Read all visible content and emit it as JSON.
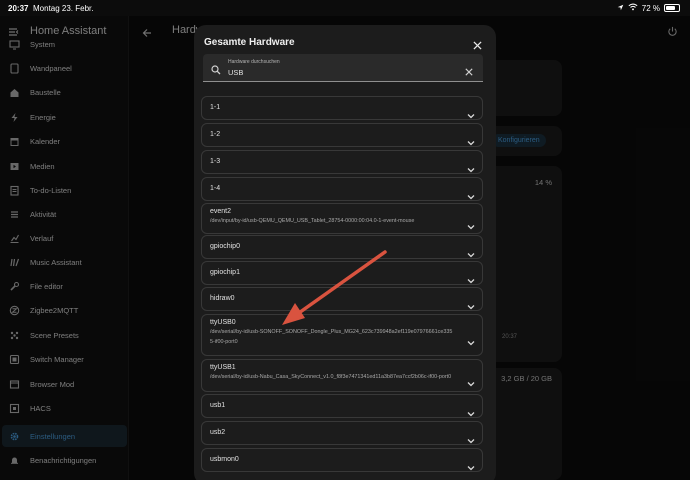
{
  "status": {
    "time": "20:37",
    "date": "Montag 23. Febr.",
    "battery": "72 %",
    "battery_level": 0.72
  },
  "sidebar": {
    "title": "Home Assistant",
    "items": [
      {
        "label": "System",
        "icon": "monitor-icon"
      },
      {
        "label": "Wandpaneel",
        "icon": "tablet-icon"
      },
      {
        "label": "Baustelle",
        "icon": "home-icon"
      },
      {
        "label": "Energie",
        "icon": "lightning-icon"
      },
      {
        "label": "Kalender",
        "icon": "calendar-icon"
      },
      {
        "label": "Medien",
        "icon": "media-icon"
      },
      {
        "label": "To-do-Listen",
        "icon": "clipboard-icon"
      },
      {
        "label": "Aktivität",
        "icon": "list-icon"
      },
      {
        "label": "Verlauf",
        "icon": "chart-icon"
      },
      {
        "label": "Music Assistant",
        "icon": "music-icon"
      },
      {
        "label": "File editor",
        "icon": "wrench-icon"
      },
      {
        "label": "Zigbee2MQTT",
        "icon": "zigbee-icon"
      },
      {
        "label": "Scene Presets",
        "icon": "palette-icon"
      },
      {
        "label": "Switch Manager",
        "icon": "switch-icon"
      },
      {
        "label": "Browser Mod",
        "icon": "browser-icon"
      },
      {
        "label": "HACS",
        "icon": "hacs-icon"
      },
      {
        "label": "Einstellungen",
        "icon": "gear-icon",
        "active": true
      },
      {
        "label": "Benachrichtigungen",
        "icon": "bell-icon"
      }
    ]
  },
  "page": {
    "title": "Hardware"
  },
  "background": {
    "configure_label": "Konfigurieren",
    "cpu_percent": "14 %",
    "time_tick": "20:37",
    "memory": "3,2 GB / 20 GB"
  },
  "dialog": {
    "title": "Gesamte Hardware",
    "search": {
      "placeholder": "Hardware durchsuchen",
      "value": "USB"
    },
    "items": [
      {
        "name": "1-1"
      },
      {
        "name": "1-2"
      },
      {
        "name": "1-3"
      },
      {
        "name": "1-4"
      },
      {
        "name": "event2",
        "path": "/dev/input/by-id/usb-QEMU_QEMU_USB_Tablet_28754-0000:00:04.0-1-event-mouse"
      },
      {
        "name": "gpiochip0"
      },
      {
        "name": "gpiochip1"
      },
      {
        "name": "hidraw0"
      },
      {
        "name": "ttyUSB0",
        "path": "/dev/serial/by-id/usb-SONOFF_SONOFF_Dongle_Plus_MG24_623c739948a2ef119e07976661ce3355-if00-port0"
      },
      {
        "name": "ttyUSB1",
        "path": "/dev/serial/by-id/usb-Nabu_Casa_SkyConnect_v1.0_f8f3e7471341ed11a3b87ea7ccf2b06c-if00-port0"
      },
      {
        "name": "usb1"
      },
      {
        "name": "usb2"
      },
      {
        "name": "usbmon0"
      }
    ]
  },
  "colors": {
    "accent": "#4ea6ea",
    "annotation_arrow": "#d9533f"
  }
}
